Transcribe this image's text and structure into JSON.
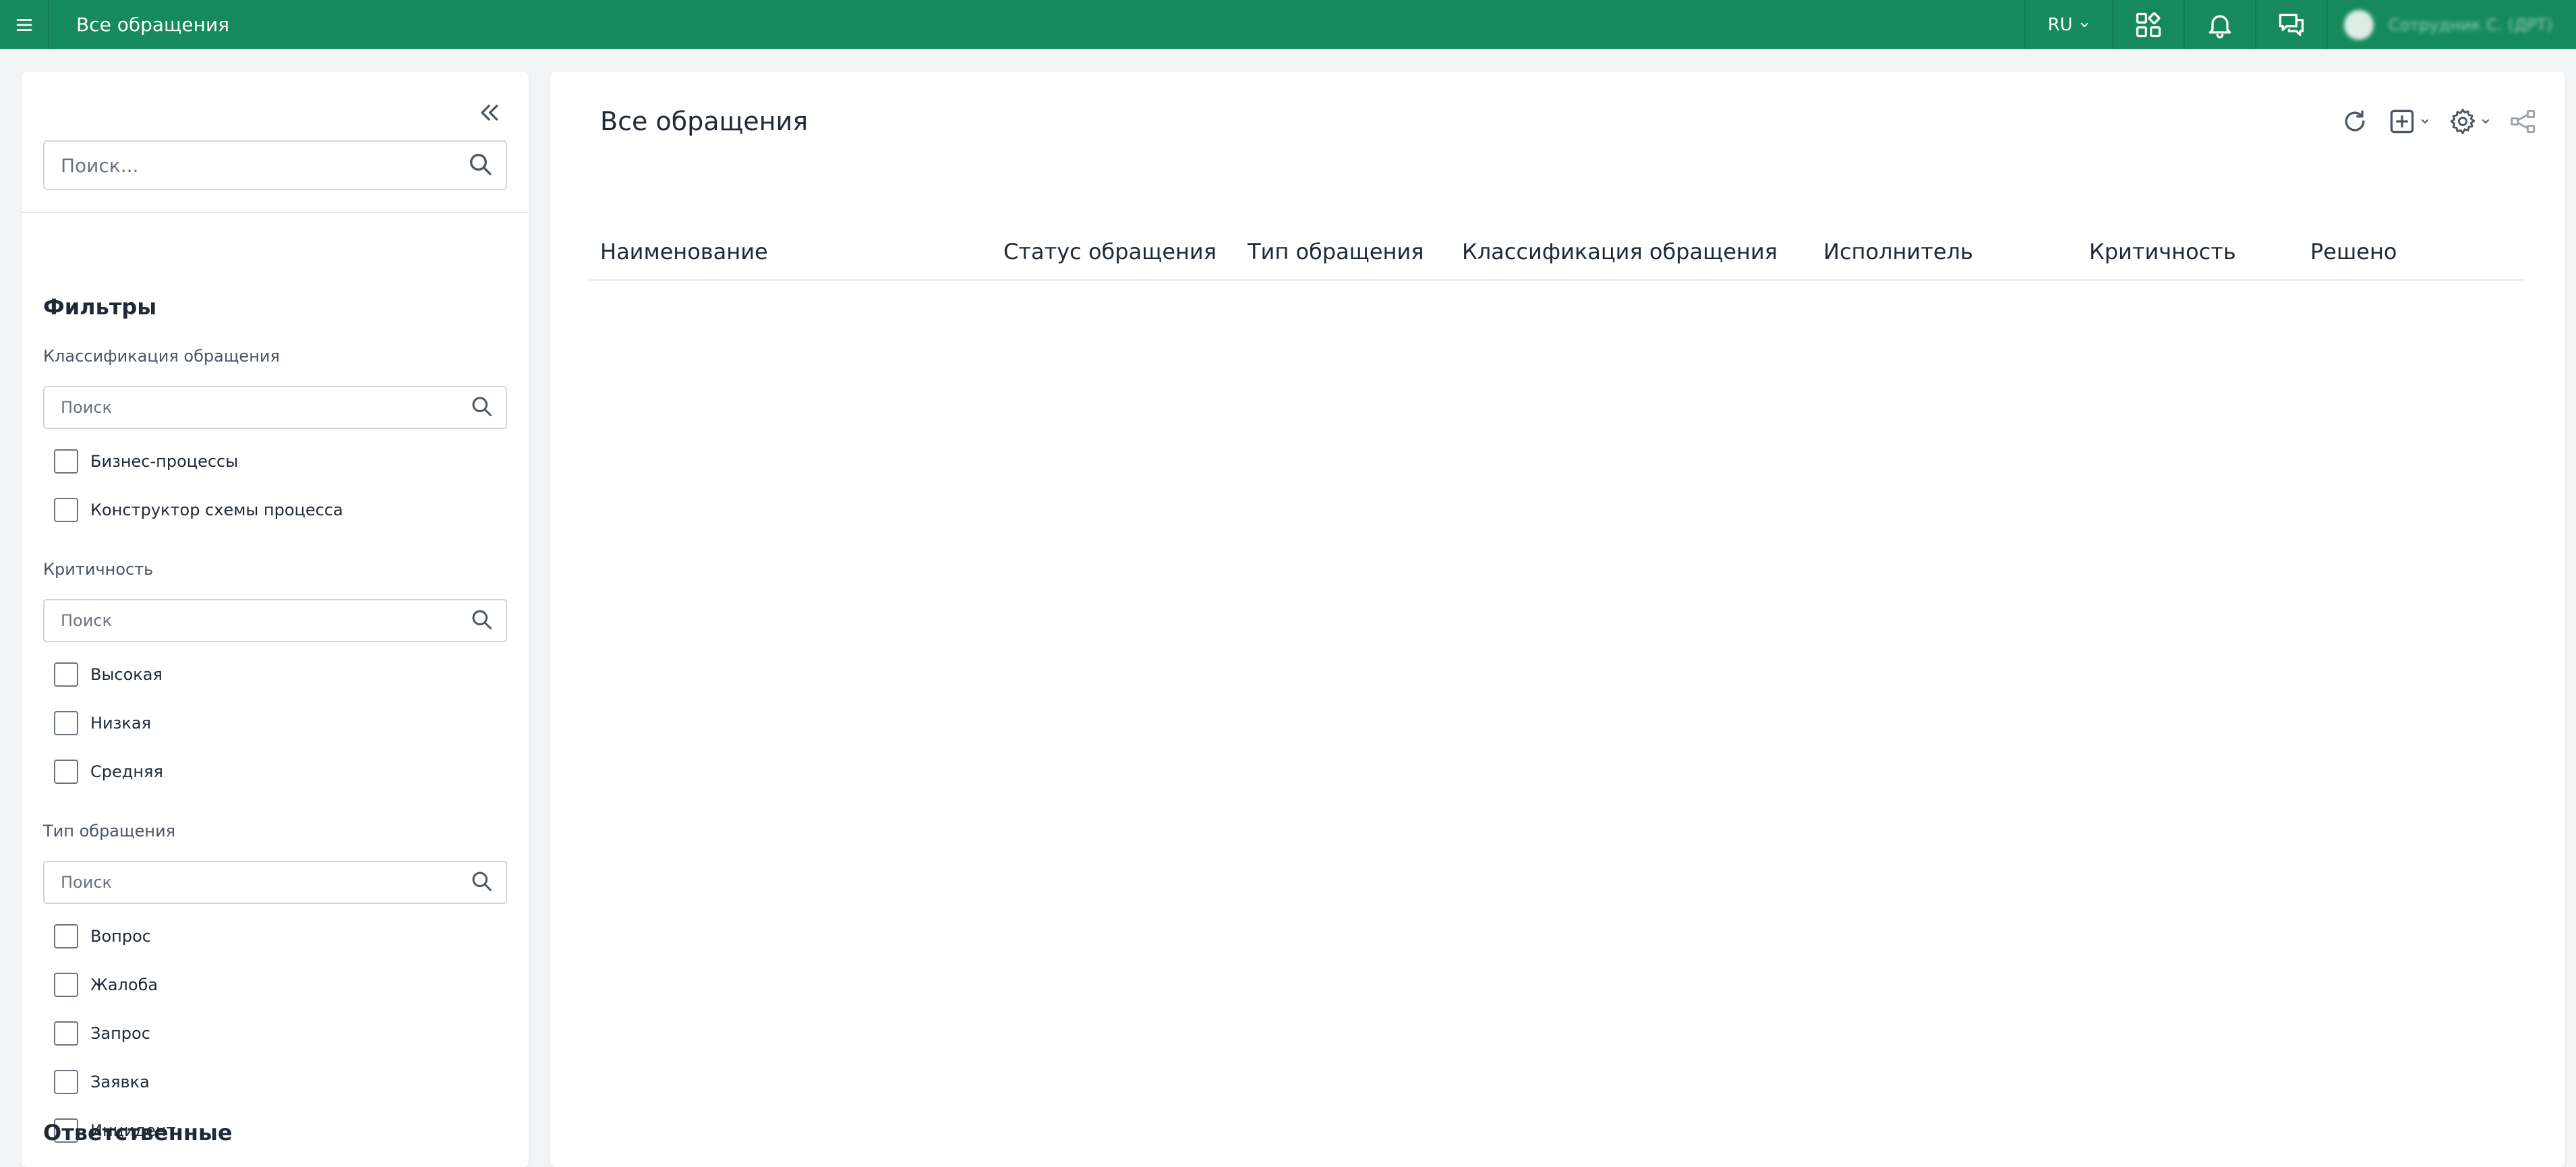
{
  "topbar": {
    "title": "Все обращения",
    "language": "RU",
    "user_name": "Сотрудник С. (ДРТ)",
    "icons": [
      "menu-icon",
      "apps-icon",
      "bell-icon",
      "chat-icon",
      "chevron-down-icon"
    ],
    "background_color": "#168a5c"
  },
  "sidebar": {
    "search_placeholder": "Поиск...",
    "filters_title": "Фильтры",
    "groups": [
      {
        "label": "Классификация обращения",
        "search_placeholder": "Поиск",
        "options": [
          "Бизнес-процессы",
          "Конструктор схемы процесса"
        ]
      },
      {
        "label": "Критичность",
        "search_placeholder": "Поиск",
        "options": [
          "Высокая",
          "Низкая",
          "Средняя"
        ]
      },
      {
        "label": "Тип обращения",
        "search_placeholder": "Поиск",
        "options": [
          "Вопрос",
          "Жалоба",
          "Запрос",
          "Заявка",
          "Инцидент"
        ]
      }
    ],
    "responsible_title": "Ответственные"
  },
  "main": {
    "title": "Все обращения",
    "toolbar_icons": [
      "refresh-icon",
      "add-icon",
      "settings-icon",
      "share-icon"
    ],
    "columns": [
      "Наименование",
      "Статус обращения",
      "Тип обращения",
      "Классификация обращения",
      "Исполнитель",
      "Критичность",
      "Решено"
    ],
    "rows": []
  }
}
